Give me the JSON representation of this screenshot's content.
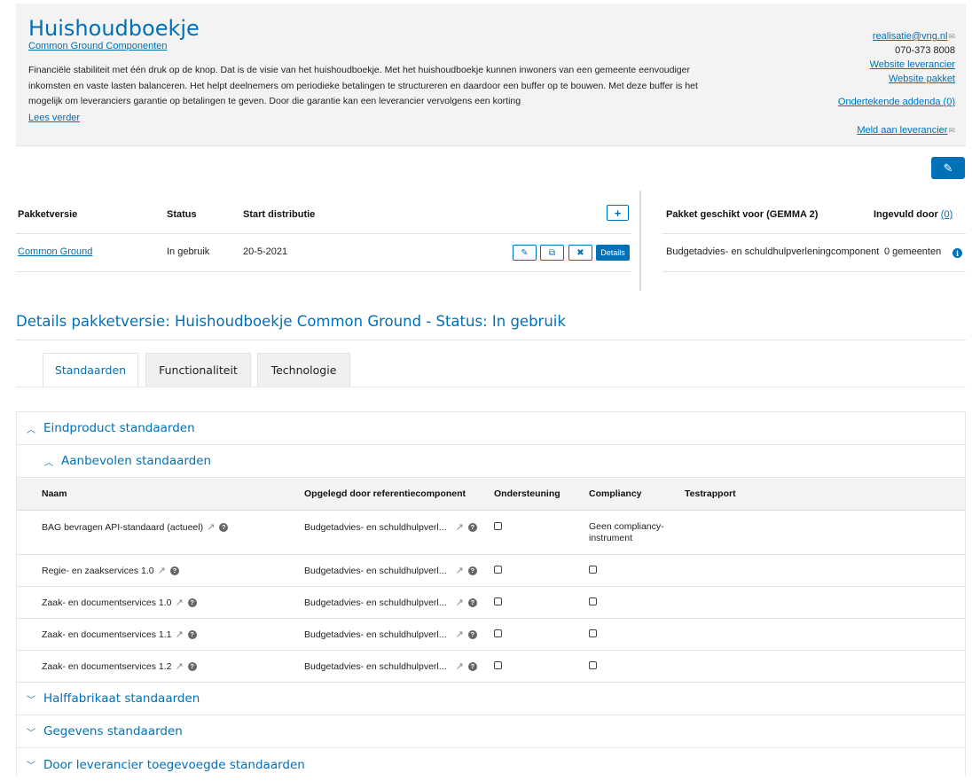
{
  "header": {
    "title": "Huishoudboekje",
    "subtitle_link": "Common Ground Componenten",
    "description": "Financiële stabiliteit met één druk op de knop. Dat is de visie van het huishoudboekje. Met het huishoudboekje kunnen inwoners van een gemeente eenvoudiger inkomsten en vaste lasten balanceren. Het helpt deelnemers om periodieke betalingen te structureren en daardoor een buffer op te bouwen. Met deze buffer is het mogelijk om leveranciers garantie op betalingen te geven. Door die garantie kan een leverancier vervolgens een korting",
    "read_more": "Lees verder",
    "contact": {
      "email": "realisatie@vng.nl",
      "phone": "070-373 8008",
      "website_supplier": "Website leverancier",
      "website_package": "Website pakket",
      "addenda": "Ondertekende addenda (0)",
      "report": "Meld aan leverancier"
    },
    "edit_icon": "pencil-icon"
  },
  "versions": {
    "columns": [
      "Pakketversie",
      "Status",
      "Start distributie"
    ],
    "add_icon": "plus-icon",
    "rows": [
      {
        "name": "Common Ground",
        "status": "In gebruik",
        "start": "20-5-2021",
        "details_label": "Details"
      }
    ]
  },
  "suitability": {
    "col_for": "Pakket geschikt voor (GEMMA 2)",
    "col_by": "Ingevuld door",
    "col_by_count": "(0)",
    "rows": [
      {
        "component": "Budgetadvies- en schuldhulpverleningcomponent",
        "count": "0 gemeenten"
      }
    ]
  },
  "details": {
    "title": "Details pakketversie: Huishoudboekje Common Ground - Status: In gebruik",
    "tabs": [
      {
        "label": "Standaarden",
        "active": true
      },
      {
        "label": "Functionaliteit",
        "active": false
      },
      {
        "label": "Technologie",
        "active": false
      }
    ]
  },
  "standards": {
    "sections": {
      "eindproduct": "Eindproduct standaarden",
      "aanbevolen": "Aanbevolen standaarden",
      "halffabrikaat": "Halffabrikaat standaarden",
      "gegevens": "Gegevens standaarden",
      "leverancier": "Door leverancier toegevoegde standaarden"
    },
    "columns": {
      "naam": "Naam",
      "opgelegd": "Opgelegd door referentiecomponent",
      "ondersteuning": "Ondersteuning",
      "compliancy": "Compliancy",
      "testrapport": "Testrapport"
    },
    "rows": [
      {
        "naam": "BAG bevragen API-standaard (actueel)",
        "opgelegd": "Budgetadvies- en schuldhulpverl...",
        "compliancy_line1": "Geen compliancy-",
        "compliancy_line2": "instrument"
      },
      {
        "naam": "Regie- en zaakservices 1.0",
        "opgelegd": "Budgetadvies- en schuldhulpverl..."
      },
      {
        "naam": "Zaak- en documentservices 1.0",
        "opgelegd": "Budgetadvies- en schuldhulpverl..."
      },
      {
        "naam": "Zaak- en documentservices 1.1",
        "opgelegd": "Budgetadvies- en schuldhulpverl..."
      },
      {
        "naam": "Zaak- en documentservices 1.2",
        "opgelegd": "Budgetadvies- en schuldhulpverl..."
      }
    ]
  },
  "colors": {
    "accent": "#0070b7",
    "panel": "#f3f3f3"
  }
}
